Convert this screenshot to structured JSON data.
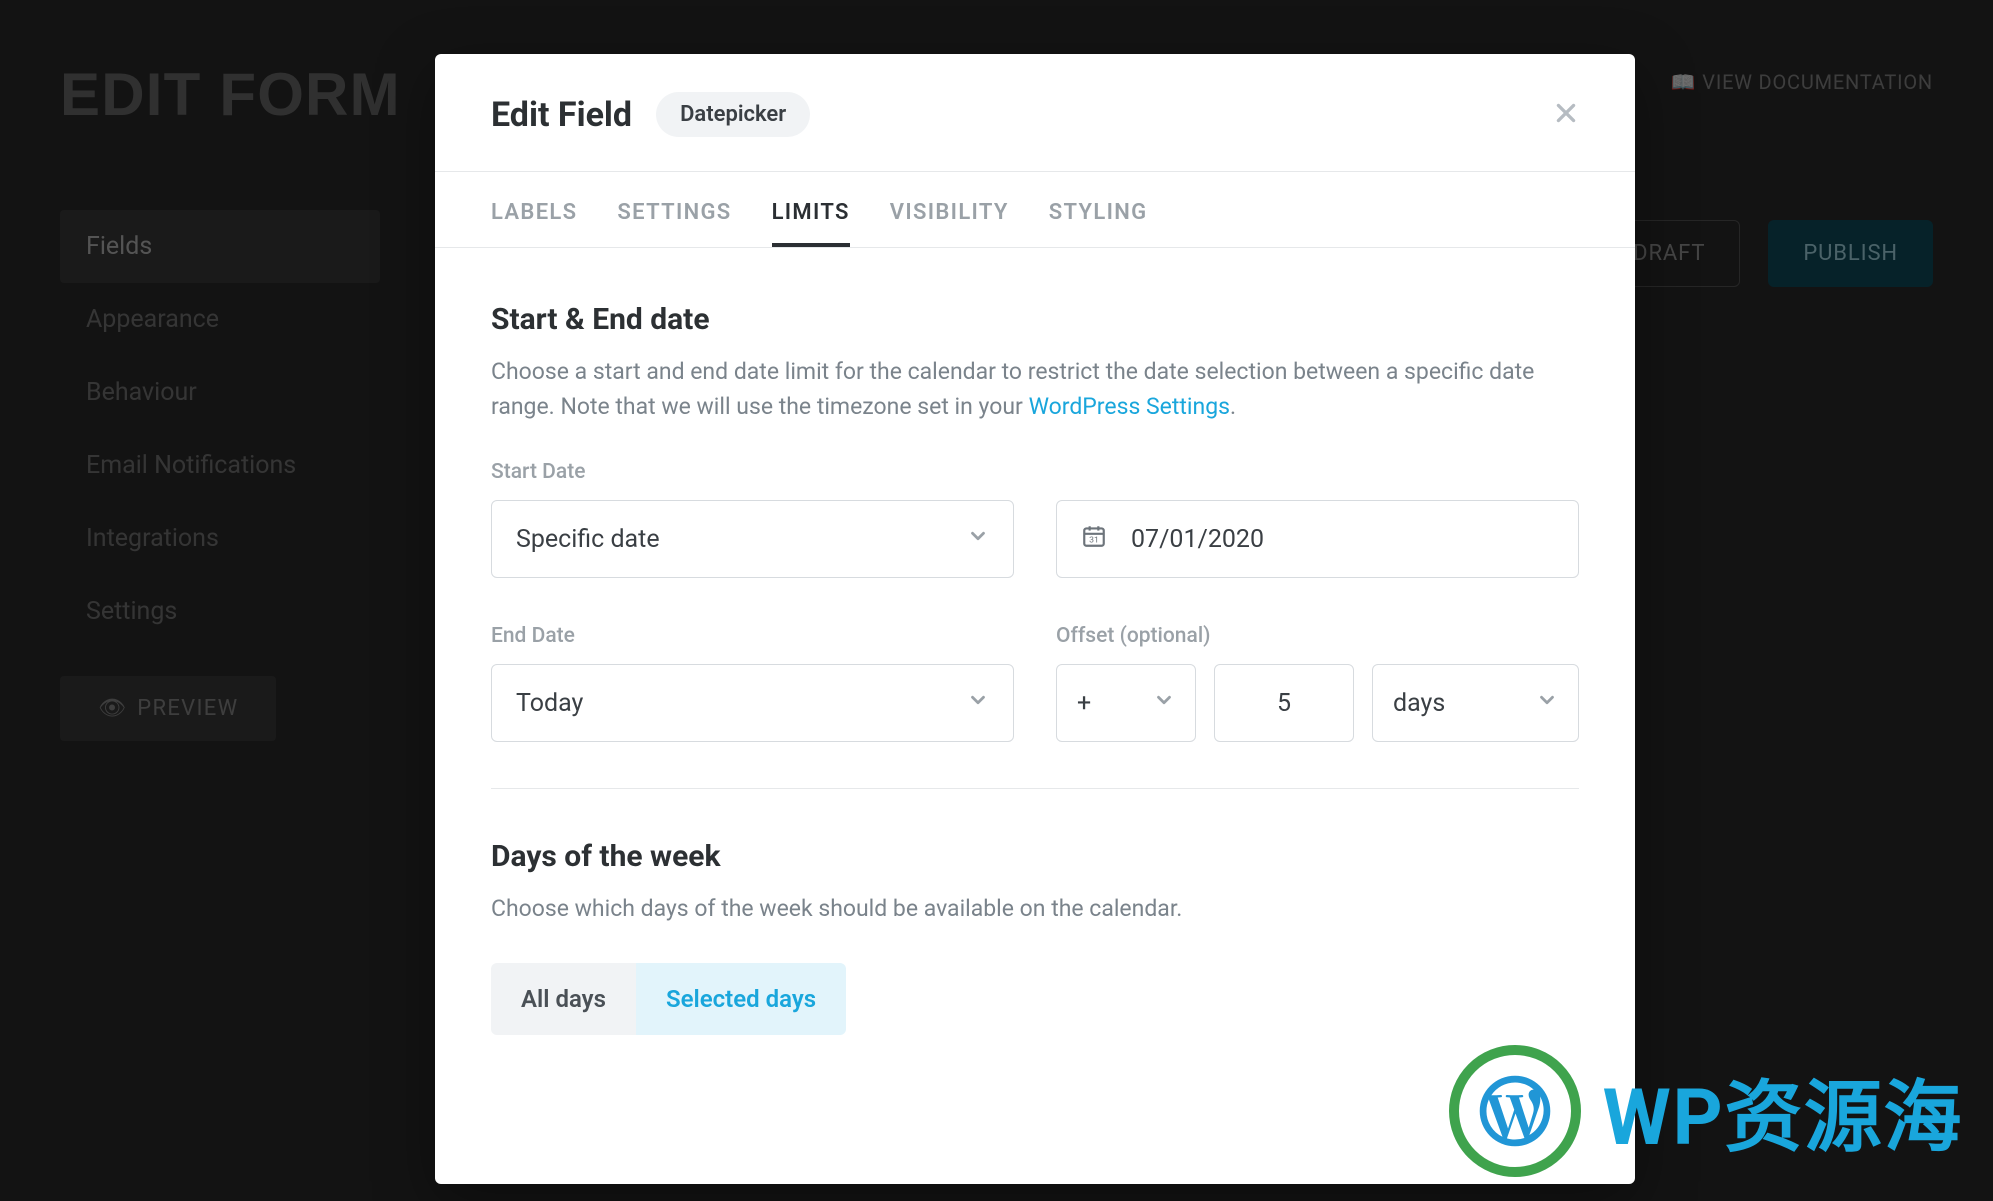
{
  "bg": {
    "title": "EDIT FORM",
    "doc_link": "📖 VIEW DOCUMENTATION",
    "sidebar": [
      "Fields",
      "Appearance",
      "Behaviour",
      "Email Notifications",
      "Integrations",
      "Settings"
    ],
    "preview_btn": "PREVIEW",
    "draft_btn": "DRAFT",
    "publish_btn": "PUBLISH"
  },
  "modal": {
    "title": "Edit Field",
    "chip": "Datepicker",
    "tabs": [
      "LABELS",
      "SETTINGS",
      "LIMITS",
      "VISIBILITY",
      "STYLING"
    ],
    "active_tab": "LIMITS"
  },
  "limits": {
    "sd_section_title": "Start & End date",
    "sd_section_desc_pre": "Choose a start and end date limit for the calendar to restrict the date selection between a specific date range. Note that we will use the timezone set in your ",
    "sd_section_link": "WordPress Settings",
    "sd_section_desc_post": ".",
    "start_label": "Start Date",
    "start_mode": "Specific date",
    "start_value": "07/01/2020",
    "end_label": "End Date",
    "end_mode": "Today",
    "offset_label": "Offset (optional)",
    "offset_sign": "+",
    "offset_num": "5",
    "offset_unit": "days",
    "dow_title": "Days of the week",
    "dow_desc": "Choose which days of the week should be available on the calendar.",
    "dow_opt_all": "All days",
    "dow_opt_sel": "Selected days"
  },
  "watermark": {
    "text": "WP资源海"
  },
  "colors": {
    "accent": "#19a6dc"
  }
}
